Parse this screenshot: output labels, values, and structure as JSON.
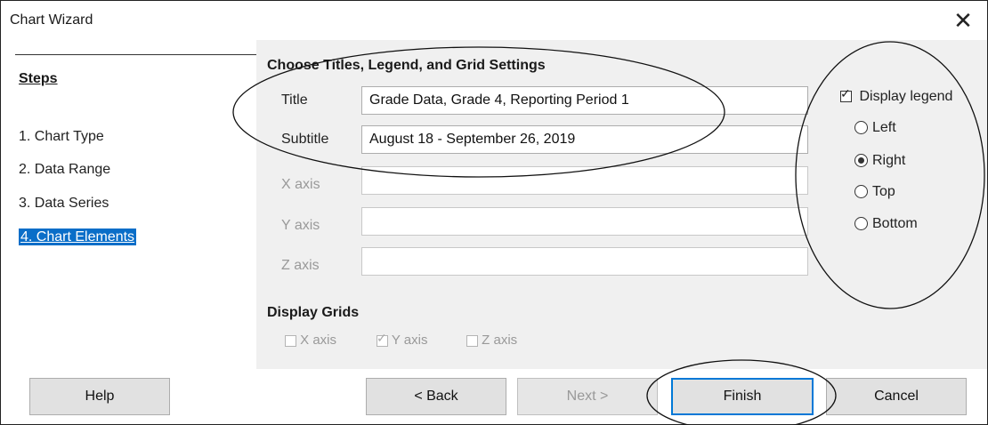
{
  "window": {
    "title": "Chart Wizard",
    "close_glyph": "✕"
  },
  "steps": {
    "heading": "Steps",
    "items": [
      {
        "label": "1. Chart Type"
      },
      {
        "label": "2. Data Range"
      },
      {
        "label": "3. Data Series"
      },
      {
        "label": "4. Chart Elements",
        "active": true
      }
    ]
  },
  "content": {
    "heading": "Choose Titles, Legend, and Grid Settings",
    "fields": [
      {
        "label": "Title",
        "value": "Grade Data, Grade 4, Reporting Period 1",
        "enabled": true
      },
      {
        "label": "Subtitle",
        "value": "August 18 - September 26, 2019",
        "enabled": true
      },
      {
        "label": "X axis",
        "value": "",
        "enabled": false
      },
      {
        "label": "Y axis",
        "value": "",
        "enabled": false
      },
      {
        "label": "Z axis",
        "value": "",
        "enabled": false
      }
    ],
    "legend": {
      "checkbox_label": "Display legend",
      "checked": true,
      "options": [
        {
          "label": "Left",
          "selected": false
        },
        {
          "label": "Right",
          "selected": true
        },
        {
          "label": "Top",
          "selected": false
        },
        {
          "label": "Bottom",
          "selected": false
        }
      ]
    },
    "grids": {
      "heading": "Display Grids",
      "options": [
        {
          "label": "X axis",
          "checked": false
        },
        {
          "label": "Y axis",
          "checked": true
        },
        {
          "label": "Z axis",
          "checked": false
        }
      ]
    }
  },
  "buttons": {
    "help": "Help",
    "back": "< Back",
    "next": "Next >",
    "finish": "Finish",
    "cancel": "Cancel"
  },
  "colors": {
    "selection": "#0a6ec8",
    "panel": "#f0f0f0",
    "default_button_border": "#0078d7"
  }
}
